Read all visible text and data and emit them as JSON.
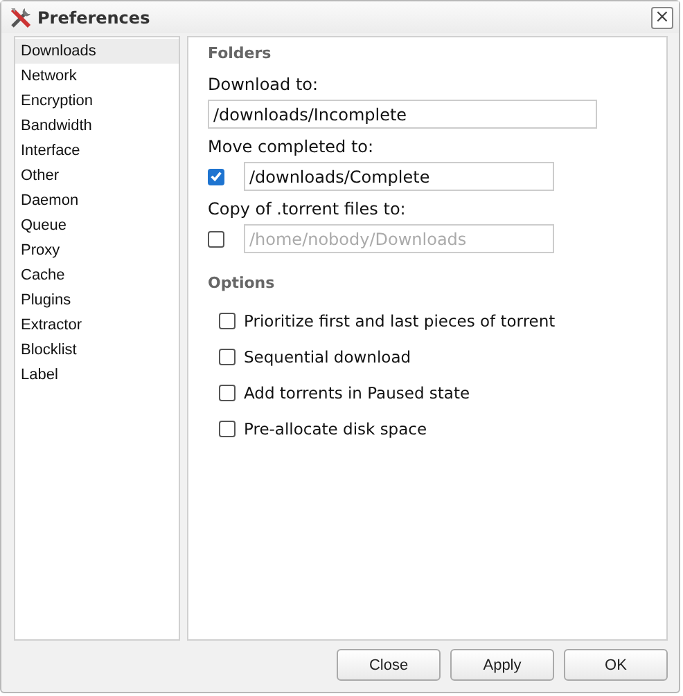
{
  "window": {
    "title": "Preferences",
    "close_glyph": "×"
  },
  "sidebar": {
    "items": [
      {
        "label": "Downloads",
        "selected": true
      },
      {
        "label": "Network",
        "selected": false
      },
      {
        "label": "Encryption",
        "selected": false
      },
      {
        "label": "Bandwidth",
        "selected": false
      },
      {
        "label": "Interface",
        "selected": false
      },
      {
        "label": "Other",
        "selected": false
      },
      {
        "label": "Daemon",
        "selected": false
      },
      {
        "label": "Queue",
        "selected": false
      },
      {
        "label": "Proxy",
        "selected": false
      },
      {
        "label": "Cache",
        "selected": false
      },
      {
        "label": "Plugins",
        "selected": false
      },
      {
        "label": "Extractor",
        "selected": false
      },
      {
        "label": "Blocklist",
        "selected": false
      },
      {
        "label": "Label",
        "selected": false
      }
    ]
  },
  "folders": {
    "heading": "Folders",
    "fields": [
      {
        "label": "Download to:",
        "value": "/downloads/Incomplete",
        "kind": "plain",
        "disabled": false
      },
      {
        "label": "Move completed to:",
        "value": "/downloads/Complete",
        "kind": "checkbox",
        "checked": true,
        "disabled": false
      },
      {
        "label": "Copy of .torrent files to:",
        "value": "/home/nobody/Downloads",
        "kind": "checkbox",
        "checked": false,
        "disabled": true
      }
    ]
  },
  "options": {
    "heading": "Options",
    "items": [
      {
        "label": "Prioritize first and last pieces of torrent",
        "checked": false
      },
      {
        "label": "Sequential download",
        "checked": false
      },
      {
        "label": "Add torrents in Paused state",
        "checked": false
      },
      {
        "label": "Pre-allocate disk space",
        "checked": false
      }
    ]
  },
  "buttons": [
    "Close",
    "Apply",
    "OK"
  ]
}
